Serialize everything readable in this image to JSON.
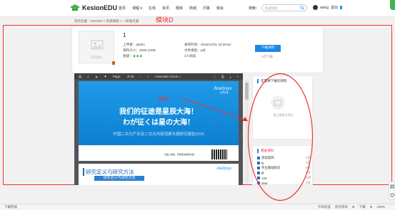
{
  "header": {
    "logo_text": "KesionEDU",
    "nav": [
      "首页",
      "课程 ▾",
      "在线",
      "资讯",
      "题库",
      "商城",
      "问答",
      "我会"
    ],
    "search_label": "搜索：",
    "search_placeholder": "快速搜索",
    "user_name": "wang",
    "logout_label": "退出"
  },
  "breadcrumb": "您的位置：KESION > 资源课程 > 一阶级页面",
  "annotations": {
    "module_d": "模块D",
    "module_e": "模块E"
  },
  "resource": {
    "title": "1",
    "thumb_label": "没有图片",
    "uploader": "上传者：admin",
    "size": "资料大小：4006.12KB",
    "rating": "星级：",
    "rating_value": "★★★",
    "publish_time": "发布时间：2016/12/31 16:26:52",
    "file_type": "文件类型：pdf",
    "views": "3人阅读",
    "download_label": "下载资料",
    "download_count": "0次下载"
  },
  "viewer": {
    "page_label": "Page:",
    "page_total": "of 39",
    "zoom": "Automatic Zoom ÷"
  },
  "slide1": {
    "brand": "Analysys",
    "brand_sub": "易观智库",
    "line1": "我们的征途是星辰大海！",
    "line2": "わが征くは星の大海！",
    "line3": "中国二次元产业及二次元内容消费专题研究报告2015",
    "qr_text": "扫描二维码，获取更多报告内容"
  },
  "slide2": {
    "brand": "Analysys",
    "section_title": "研究定义与研究方法",
    "section_bar": "研究定义与研究方法"
  },
  "sidebar": {
    "recent_title": "还需要下载的资料",
    "empty_text": "暂无需要的资料",
    "related_title": "相关资料",
    "related": [
      {
        "name": "测试案例",
        "count": "0次"
      },
      {
        "name": "tit",
        "count": "0次"
      },
      {
        "name": "专业基础知识",
        "count": "0次"
      },
      {
        "name": "fff",
        "count": "0次"
      },
      {
        "name": "123",
        "count": "0次"
      },
      {
        "name": "dear",
        "count": "0次"
      }
    ]
  },
  "status": {
    "left": "下载完成",
    "right": [
      "今日优选",
      "热点资讯",
      "⊕",
      "下载",
      "⊕",
      "100%"
    ]
  },
  "colors": {
    "accent": "#1e88e5",
    "annotation": "#ee3333",
    "logo": "#41b44b"
  }
}
